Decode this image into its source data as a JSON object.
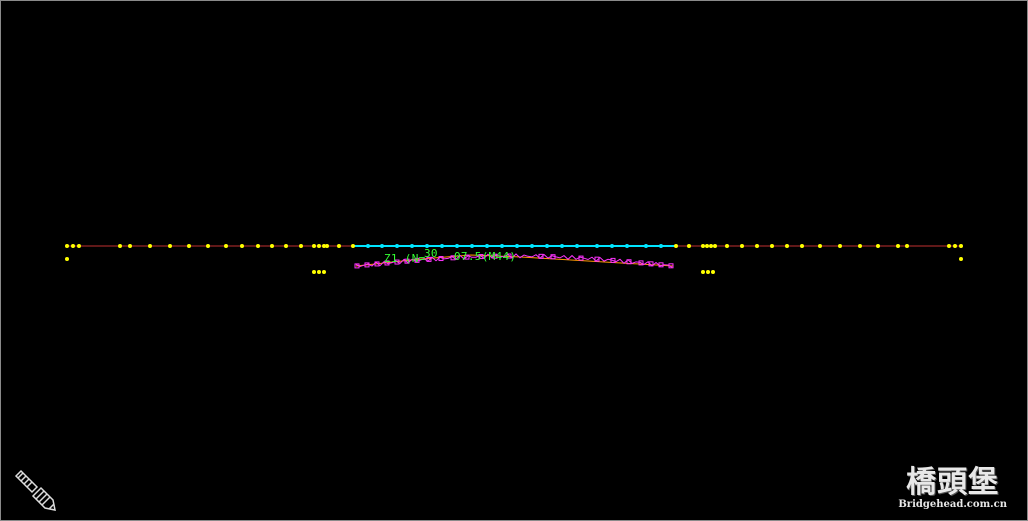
{
  "viewport": {
    "background": "#000000",
    "border_color": "#8a8a8a"
  },
  "colors": {
    "beam_line": "#c03030",
    "node": "#ffff00",
    "tendon_zone": "#00e5ff",
    "tendon_profile": "#ff33ff",
    "tendon_axis": "#ff9a00",
    "label": "#33ff33"
  },
  "tendon_labels": {
    "label_a": "Z1 (N=",
    "label_b": "30",
    "label_c": "07.5(M44)"
  },
  "watermark": {
    "logo_text": "橋頭堡",
    "site_text": "Bridgehead.com.cn"
  },
  "icons": {
    "view_icon": "ucs-pencil-icon"
  }
}
